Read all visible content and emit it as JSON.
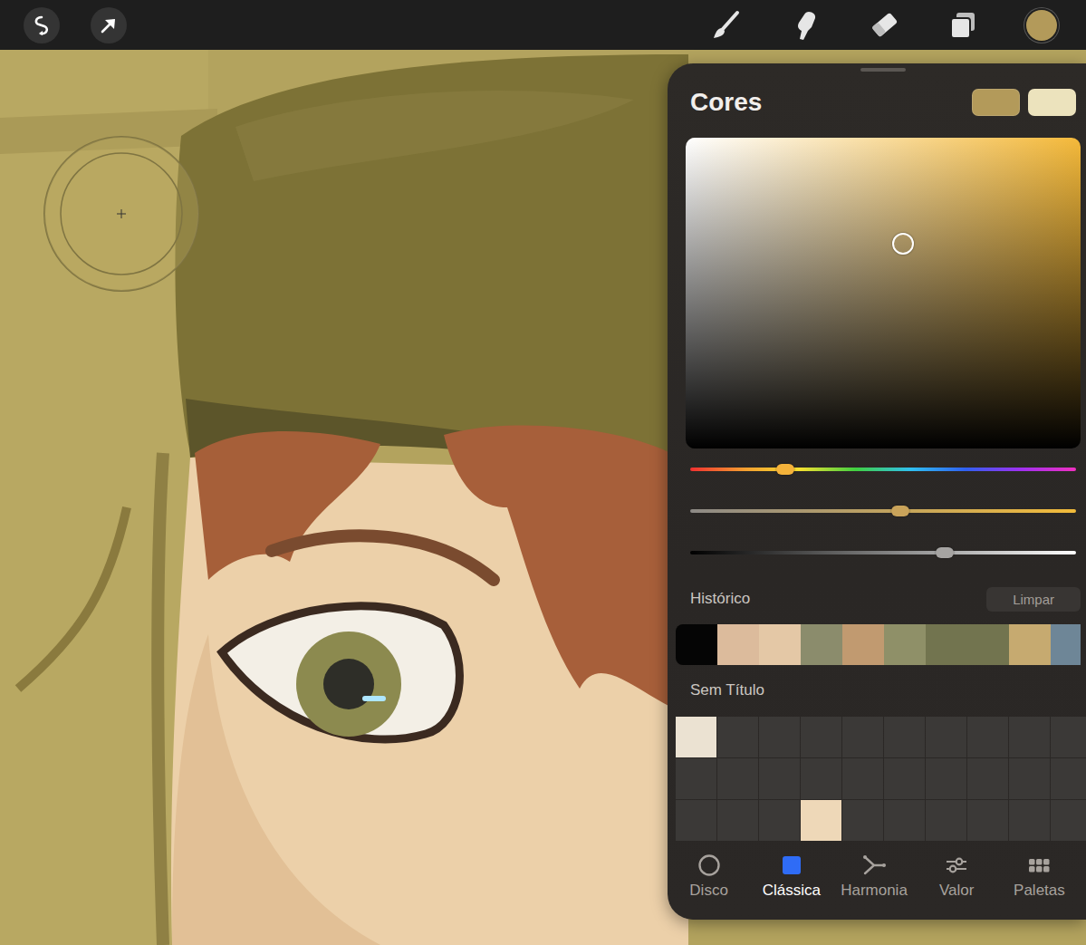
{
  "toolbar": {
    "left_tools": [
      {
        "kind": "selection",
        "selected": false
      },
      {
        "kind": "transform",
        "selected": false
      }
    ],
    "tools": [
      {
        "kind": "brush",
        "selected": false
      },
      {
        "kind": "smudge",
        "selected": false
      },
      {
        "kind": "eraser",
        "selected": false
      },
      {
        "kind": "layers",
        "selected": false
      },
      {
        "kind": "color",
        "selected": true,
        "color": "#b39a5a"
      }
    ]
  },
  "colors_panel": {
    "title": "Cores",
    "swatches": [
      {
        "color": "#b39a5a",
        "selected": true
      },
      {
        "color": "#ece3bd",
        "selected": false
      }
    ],
    "picker": {
      "hue_color": "#f4b93a",
      "level_x": 0.55,
      "level_y": 0.66
    },
    "sliders": [
      {
        "kind": "hue",
        "level": 0.246
      },
      {
        "kind": "saturation",
        "level": 0.545
      },
      {
        "kind": "brightness",
        "level": 0.66
      }
    ],
    "history": {
      "title": "Histórico",
      "clear_button": "Limpar",
      "swatches": [
        {
          "color": "#050505"
        },
        {
          "color": "#dcbb9c"
        },
        {
          "color": "#e4c8a6"
        },
        {
          "color": "#8b8c6c"
        },
        {
          "color": "#c19a70"
        },
        {
          "color": "#8f9068"
        },
        {
          "color": "#72744f"
        },
        {
          "color": "#72744f"
        },
        {
          "color": "#c6aa70"
        },
        {
          "color": "#6e8697"
        }
      ]
    },
    "palette": {
      "title": "Sem Título",
      "cells": [
        {
          "color": "#ebe2d2"
        },
        {
          "color": null
        },
        {
          "color": null
        },
        {
          "color": null
        },
        {
          "color": null
        },
        {
          "color": null
        },
        {
          "color": null
        },
        {
          "color": null
        },
        {
          "color": null
        },
        {
          "color": null
        },
        {
          "color": null
        },
        {
          "color": null
        },
        {
          "color": null
        },
        {
          "color": null
        },
        {
          "color": null
        },
        {
          "color": null
        },
        {
          "color": null
        },
        {
          "color": null
        },
        {
          "color": null
        },
        {
          "color": null
        },
        {
          "color": null
        },
        {
          "color": null
        },
        {
          "color": null
        },
        {
          "color": "#eed8b8"
        },
        {
          "color": null
        },
        {
          "color": null
        },
        {
          "color": null
        },
        {
          "color": null
        },
        {
          "color": null
        },
        {
          "color": null
        }
      ]
    },
    "tabs": [
      {
        "label": "Disco",
        "kind": "disc",
        "selected": false
      },
      {
        "label": "Clássica",
        "kind": "classic",
        "selected": true
      },
      {
        "label": "Harmonia",
        "kind": "harmony",
        "selected": false
      },
      {
        "label": "Valor",
        "kind": "value",
        "selected": false
      },
      {
        "label": "Paletas",
        "kind": "palettes",
        "selected": false
      }
    ]
  }
}
